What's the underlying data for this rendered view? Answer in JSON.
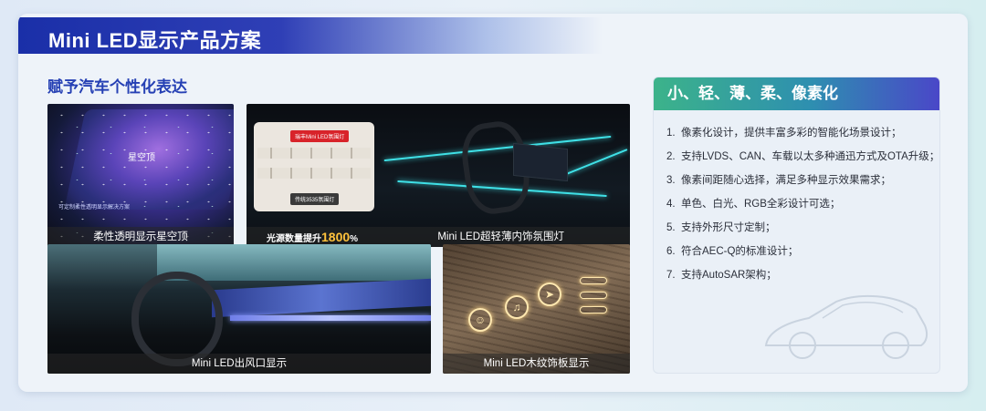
{
  "header": {
    "title": "Mini LED显示产品方案"
  },
  "section": {
    "subtitle": "赋予汽车个性化表达"
  },
  "tiles": {
    "starry_roof": {
      "caption": "柔性透明显示星空顶",
      "inner_label": "星空顶",
      "inner_small": "可定制柔性透明显示解决方案"
    },
    "ambient_light": {
      "caption": "Mini LED超轻薄内饰氛围灯",
      "tag_top": "瑞丰Mini LED氛围灯",
      "tag_bottom": "传统3535氛围灯",
      "boost_label": "光源数量提升",
      "boost_value": "1800",
      "boost_unit": "%"
    },
    "air_vent": {
      "caption": "Mini LED出风口显示"
    },
    "wood_panel": {
      "caption": "Mini LED木纹饰板显示"
    }
  },
  "panel": {
    "title": "小、轻、薄、柔、像素化",
    "items": [
      {
        "num": "1.",
        "text": "像素化设计，提供丰富多彩的智能化场景设计；"
      },
      {
        "num": "2.",
        "text": "支持LVDS、CAN、车载以太多种通迅方式及OTA升级；"
      },
      {
        "num": "3.",
        "text": "像素间距随心选择，满足多种显示效果需求；"
      },
      {
        "num": "4.",
        "text": "单色、白光、RGB全彩设计可选；"
      },
      {
        "num": "5.",
        "text": "支持外形尺寸定制；"
      },
      {
        "num": "6.",
        "text": "符合AEC-Q的标准设计；"
      },
      {
        "num": "7.",
        "text": "支持AutoSAR架构；"
      }
    ]
  },
  "colors": {
    "title_bar": "#1a2fa8",
    "subtitle": "#2540b4",
    "panel_head_start": "#3cb38a",
    "panel_head_end": "#4a47c8",
    "ambient": "#3fe0e6",
    "highlight": "#ffc23c"
  },
  "icons": [
    "car-outline-icon",
    "face-icon",
    "music-note-icon",
    "navigation-icon"
  ]
}
